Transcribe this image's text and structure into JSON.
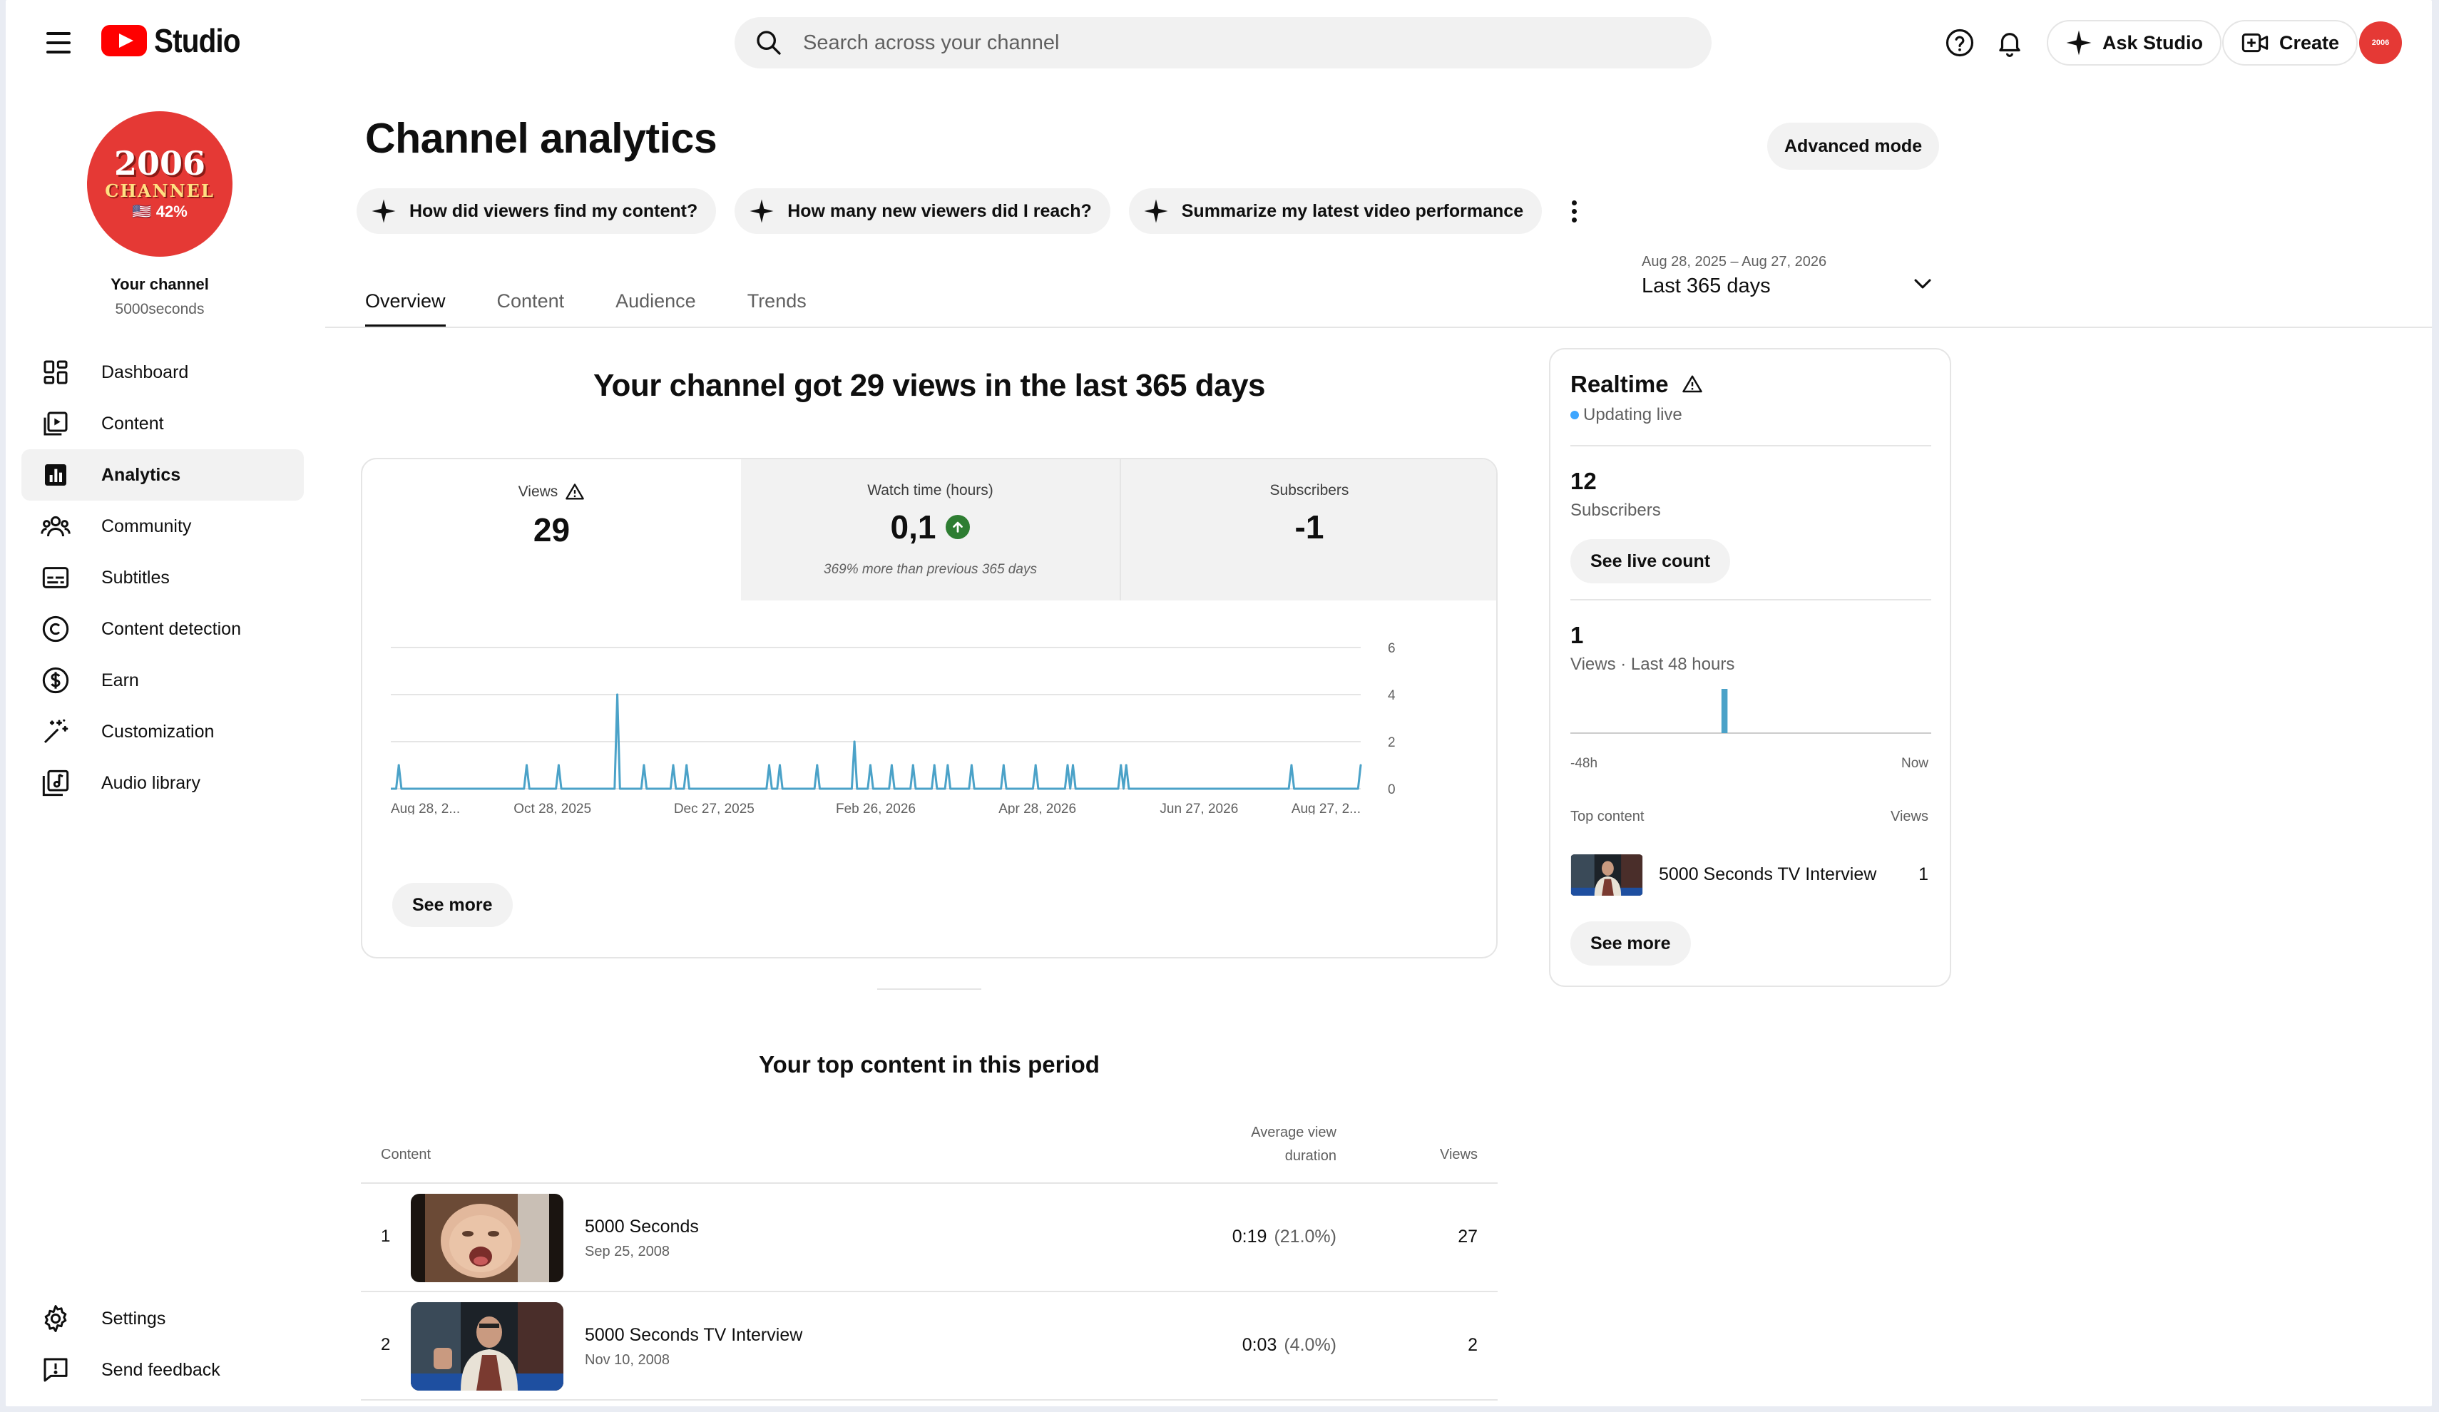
{
  "header": {
    "logo_text": "Studio",
    "search_placeholder": "Search across your channel",
    "ask_studio_label": "Ask Studio",
    "create_label": "Create",
    "avatar_text": "2006"
  },
  "sidebar": {
    "channel_avatar": {
      "year": "2006",
      "label": "CHANNEL",
      "pct": "🇺🇸 42%"
    },
    "your_channel_label": "Your channel",
    "handle": "5000seconds",
    "items": [
      {
        "label": "Dashboard",
        "icon": "dashboard-icon"
      },
      {
        "label": "Content",
        "icon": "content-icon"
      },
      {
        "label": "Analytics",
        "icon": "analytics-icon",
        "active": true
      },
      {
        "label": "Community",
        "icon": "community-icon"
      },
      {
        "label": "Subtitles",
        "icon": "subtitles-icon"
      },
      {
        "label": "Content detection",
        "icon": "copyright-icon"
      },
      {
        "label": "Earn",
        "icon": "dollar-icon"
      },
      {
        "label": "Customization",
        "icon": "magic-wand-icon"
      },
      {
        "label": "Audio library",
        "icon": "audio-library-icon"
      }
    ],
    "bottom_items": [
      {
        "label": "Settings",
        "icon": "gear-icon"
      },
      {
        "label": "Send feedback",
        "icon": "feedback-icon"
      }
    ]
  },
  "main": {
    "title": "Channel analytics",
    "advanced_mode_label": "Advanced mode",
    "chips": [
      "How did viewers find my content?",
      "How many new viewers did I reach?",
      "Summarize my latest video performance"
    ],
    "tabs": [
      {
        "label": "Overview",
        "active": true
      },
      {
        "label": "Content"
      },
      {
        "label": "Audience"
      },
      {
        "label": "Trends"
      }
    ],
    "date_range": {
      "range": "Aug 28, 2025 – Aug 27, 2026",
      "label": "Last 365 days"
    },
    "headline": "Your channel got 29 views in the last 365 days",
    "metrics": {
      "views": {
        "label": "Views",
        "value": "29"
      },
      "watch_time": {
        "label": "Watch time (hours)",
        "value": "0,1",
        "note": "369% more than previous 365 days"
      },
      "subscribers": {
        "label": "Subscribers",
        "value": "-1"
      }
    },
    "see_more_label": "See more",
    "top_content": {
      "title": "Your top content in this period",
      "col_content": "Content",
      "col_avg_line1": "Average view",
      "col_avg_line2": "duration",
      "col_views": "Views",
      "rows": [
        {
          "index": "1",
          "title": "5000 Seconds",
          "date": "Sep 25, 2008",
          "duration": "0:19",
          "pct": "(21.0%)",
          "views": "27"
        },
        {
          "index": "2",
          "title": "5000 Seconds TV Interview",
          "date": "Nov 10, 2008",
          "duration": "0:03",
          "pct": "(4.0%)",
          "views": "2"
        }
      ]
    }
  },
  "realtime": {
    "title": "Realtime",
    "status": "Updating live",
    "subscribers_value": "12",
    "subscribers_label": "Subscribers",
    "see_live_label": "See live count",
    "views_value": "1",
    "views_label": "Views · Last 48 hours",
    "axis_left": "-48h",
    "axis_right": "Now",
    "top_content_label": "Top content",
    "top_views_label": "Views",
    "top_video_title": "5000 Seconds TV Interview",
    "top_video_views": "1",
    "see_more_label": "See more",
    "spark": {
      "bars": 48,
      "peak_index": 20,
      "peak_value": 1
    }
  },
  "colors": {
    "accent": "#4ba2c8",
    "brand": "#ff0000",
    "positive": "#2e7d32",
    "live": "#3ea6ff"
  },
  "chart_data": {
    "type": "line",
    "ylim": [
      0,
      6
    ],
    "yticks": [
      0,
      2,
      4,
      6
    ],
    "x_tick_labels": [
      "Aug 28, 2...",
      "Oct 28, 2025",
      "Dec 27, 2025",
      "Feb 26, 2026",
      "Apr 28, 2026",
      "Jun 27, 2026",
      "Aug 27, 2..."
    ],
    "x_start": "2025-08-28",
    "x_end": "2026-08-27",
    "points": [
      {
        "date": "2025-08-31",
        "value": 1
      },
      {
        "date": "2025-10-18",
        "value": 1
      },
      {
        "date": "2025-10-30",
        "value": 1
      },
      {
        "date": "2025-11-21",
        "value": 4
      },
      {
        "date": "2025-12-01",
        "value": 1
      },
      {
        "date": "2025-12-12",
        "value": 1
      },
      {
        "date": "2025-12-17",
        "value": 1
      },
      {
        "date": "2026-01-17",
        "value": 1
      },
      {
        "date": "2026-01-21",
        "value": 1
      },
      {
        "date": "2026-02-04",
        "value": 1
      },
      {
        "date": "2026-02-18",
        "value": 2
      },
      {
        "date": "2026-02-24",
        "value": 1
      },
      {
        "date": "2026-03-04",
        "value": 1
      },
      {
        "date": "2026-03-12",
        "value": 1
      },
      {
        "date": "2026-03-20",
        "value": 1
      },
      {
        "date": "2026-03-25",
        "value": 1
      },
      {
        "date": "2026-04-03",
        "value": 1
      },
      {
        "date": "2026-04-15",
        "value": 1
      },
      {
        "date": "2026-04-27",
        "value": 1
      },
      {
        "date": "2026-05-09",
        "value": 1
      },
      {
        "date": "2026-05-11",
        "value": 1
      },
      {
        "date": "2026-05-29",
        "value": 1
      },
      {
        "date": "2026-05-31",
        "value": 1
      },
      {
        "date": "2026-08-01",
        "value": 1
      },
      {
        "date": "2026-08-27",
        "value": 1
      }
    ]
  }
}
